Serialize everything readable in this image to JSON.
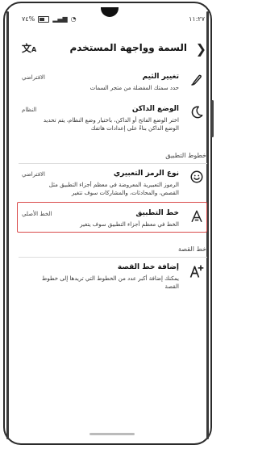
{
  "status": {
    "time": "١١:٢٧",
    "battery": "٧٤%"
  },
  "header": {
    "title": "السمة وواجهة المستخدم",
    "back_icon": "chevron-left-icon",
    "translate_icon": "translate-icon"
  },
  "items": {
    "theme": {
      "title": "تغيير الثيم",
      "value": "الافتراضي",
      "desc": "حدد سمتك المفضلة من متجر السمات",
      "icon": "paintbrush-icon"
    },
    "dark": {
      "title": "الوضع الداكن",
      "value": "النظام",
      "desc": "اختر الوضع الفاتح أو الداكن، باختيار وضع النظام، يتم تحديد الوضع الداكن بناءً على إعدادات هاتفك",
      "icon": "moon-icon"
    },
    "emoji": {
      "title": "نوع الرمز التعبيري",
      "value": "الافتراضي",
      "desc": "الرموز التعبيرية المعروضة في معظم أجزاء التطبيق مثل القصص، والمحادثات، والمشاركات سوف تتغير",
      "icon": "smiley-icon"
    },
    "font": {
      "title": "خط التطبيق",
      "value": "الخط الأصلي",
      "desc": "الخط في معظم أجزاء التطبيق سوف يتغير",
      "icon": "font-icon"
    },
    "story_font": {
      "title": "إضافة خط القصة",
      "desc": "يمكنك إضافة أكبر عدد من الخطوط التي تريدها إلى خطوط القصة",
      "icon": "add-font-icon"
    }
  },
  "sections": {
    "app_fonts": "خطوط التطبيق",
    "story": "خط القصة"
  },
  "colors": {
    "highlight": "#d94b4b"
  }
}
